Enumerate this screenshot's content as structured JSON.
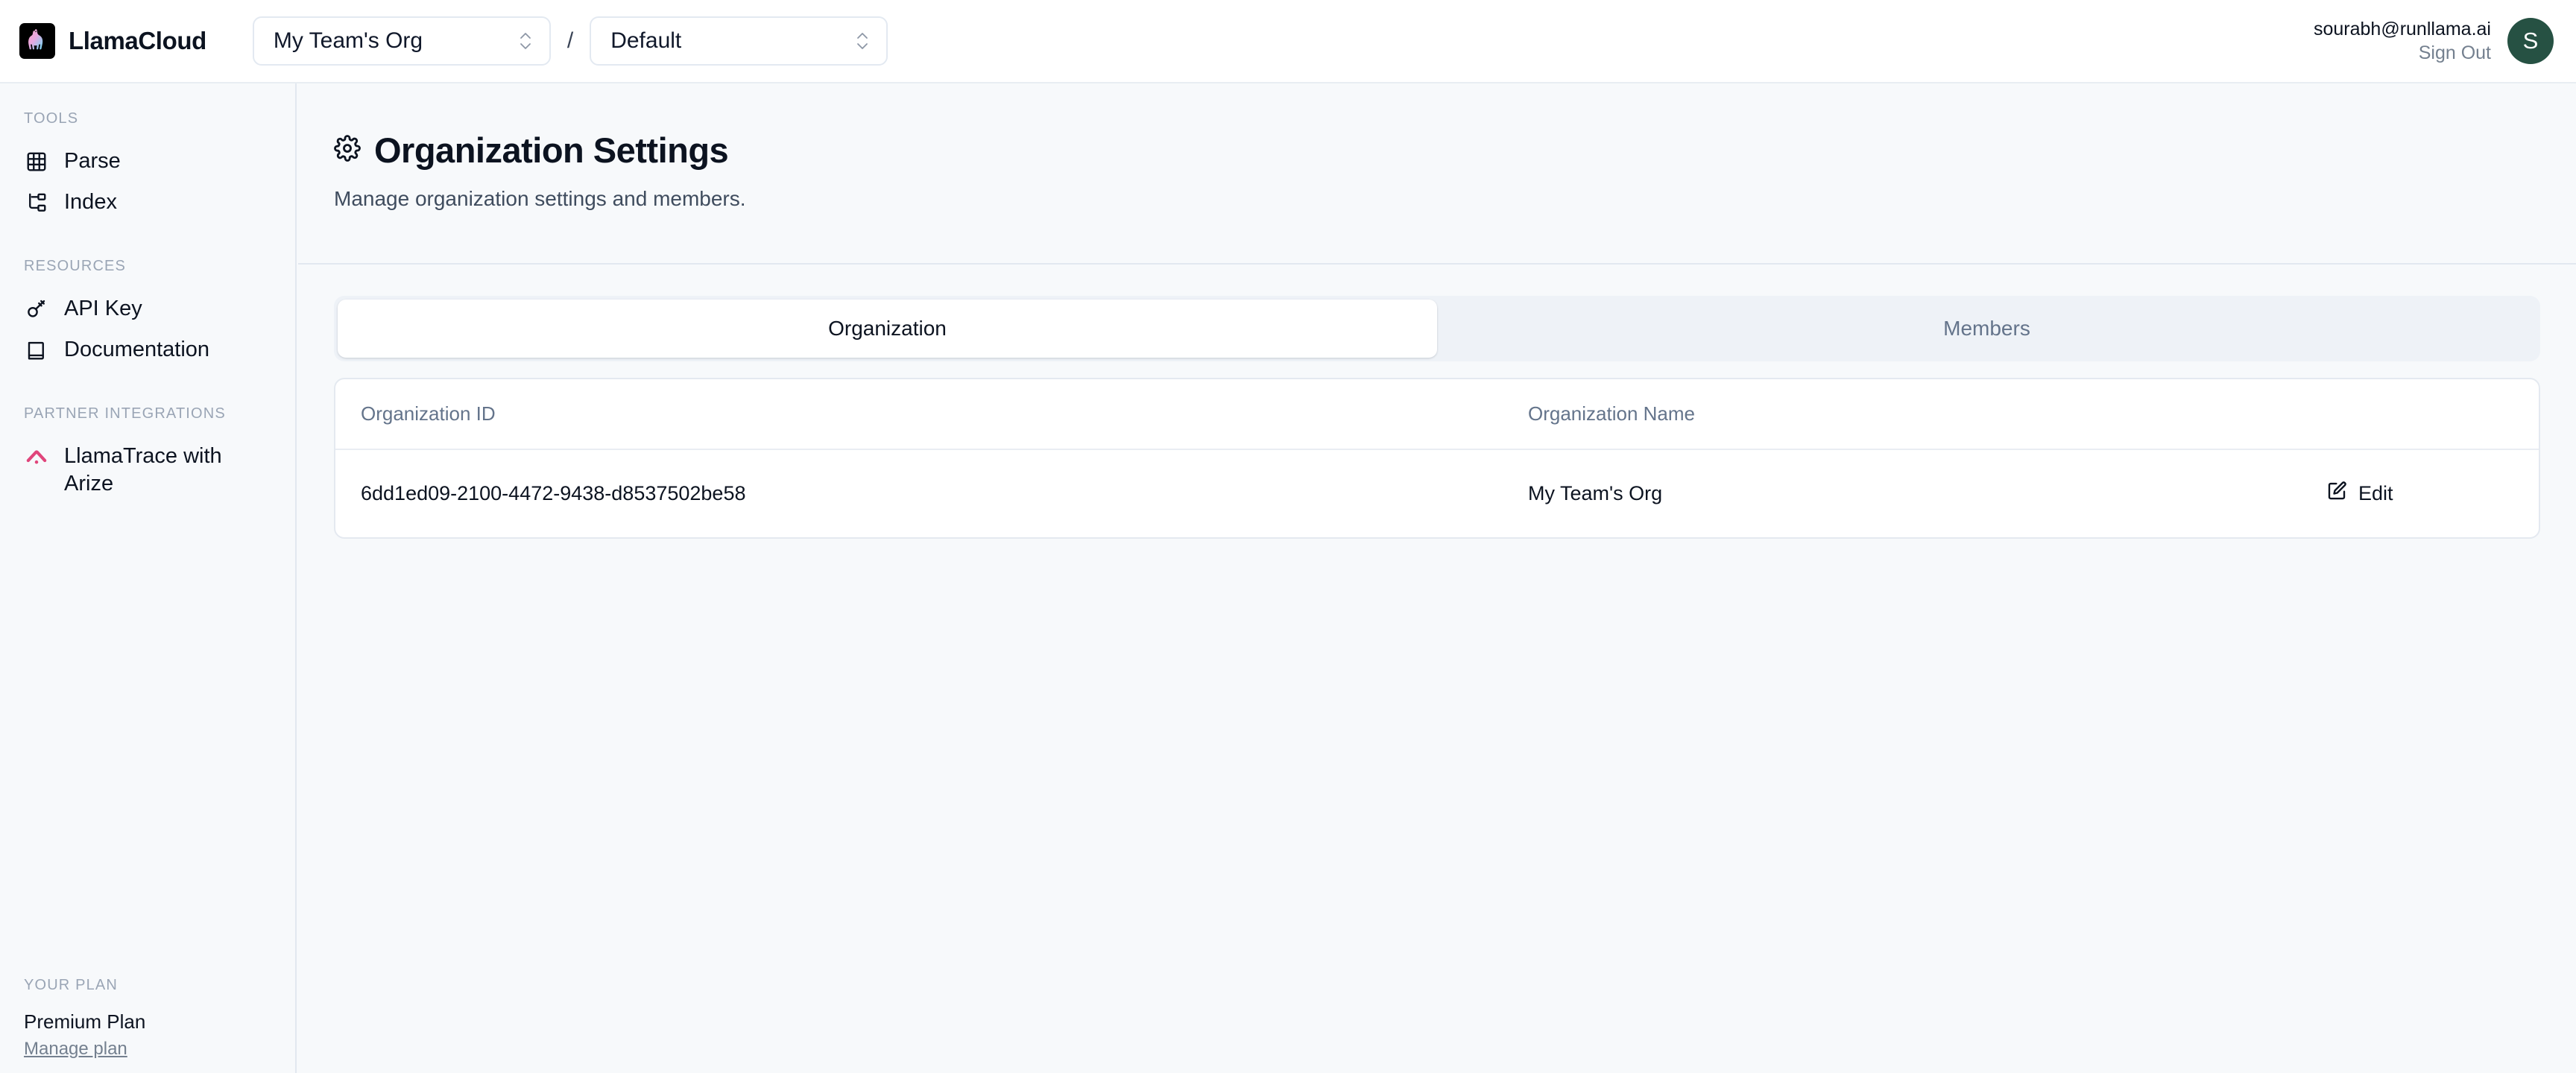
{
  "brand": {
    "name": "LlamaCloud",
    "logo_icon": "llama-logo-icon"
  },
  "header": {
    "org_select": {
      "value": "My Team's Org",
      "icon": "chevron-up-down-icon"
    },
    "separator": "/",
    "project_select": {
      "value": "Default",
      "icon": "chevron-up-down-icon"
    },
    "user_email": "sourabh@runllama.ai",
    "sign_out": "Sign Out",
    "avatar_initial": "S",
    "avatar_color": "#265143"
  },
  "sidebar": {
    "groups": [
      {
        "title": "TOOLS",
        "items": [
          {
            "label": "Parse",
            "icon": "table-grid-icon"
          },
          {
            "label": "Index",
            "icon": "hierarchy-tree-icon"
          }
        ]
      },
      {
        "title": "RESOURCES",
        "items": [
          {
            "label": "API Key",
            "icon": "key-icon"
          },
          {
            "label": "Documentation",
            "icon": "book-icon"
          }
        ]
      },
      {
        "title": "PARTNER INTEGRATIONS",
        "items": [
          {
            "label": "LlamaTrace with Arize",
            "icon": "arize-chevron-icon"
          }
        ]
      }
    ],
    "plan": {
      "title": "YOUR PLAN",
      "name": "Premium Plan",
      "manage_link": "Manage plan"
    }
  },
  "page": {
    "title": "Organization Settings",
    "title_icon": "gear-icon",
    "subtitle": "Manage organization settings and members."
  },
  "tabs": [
    {
      "label": "Organization",
      "active": true
    },
    {
      "label": "Members",
      "active": false
    }
  ],
  "table": {
    "columns": [
      "Organization ID",
      "Organization Name"
    ],
    "rows": [
      {
        "organization_id": "6dd1ed09-2100-4472-9438-d8537502be58",
        "organization_name": "My Team's Org",
        "action_label": "Edit",
        "action_icon": "square-pen-icon"
      }
    ]
  },
  "colors": {
    "page_bg": "#f7f9fb",
    "accent_pink": "#e0457b",
    "avatar_green": "#265143",
    "muted_text": "#64748b"
  }
}
